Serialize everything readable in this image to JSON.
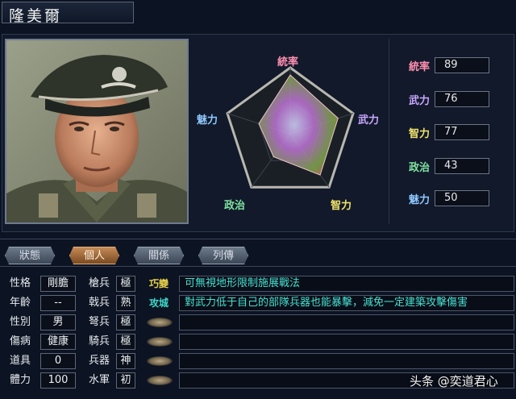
{
  "general_name": "隆美爾",
  "radar": {
    "labels": {
      "leadership": "統率",
      "strength": "武力",
      "intelligence": "智力",
      "politics": "政治",
      "charisma": "魅力"
    },
    "values": {
      "leadership": 89,
      "strength": 76,
      "intelligence": 77,
      "politics": 43,
      "charisma": 50
    },
    "max": 100
  },
  "stats": [
    {
      "name": "統率",
      "value": "89",
      "color": "#ff8fb0"
    },
    {
      "name": "武力",
      "value": "76",
      "color": "#c9a8ff"
    },
    {
      "name": "智力",
      "value": "77",
      "color": "#f2e26a"
    },
    {
      "name": "政治",
      "value": "43",
      "color": "#7fe3a0"
    },
    {
      "name": "魅力",
      "value": "50",
      "color": "#8fc8ff"
    }
  ],
  "tabs": [
    {
      "label": "狀態",
      "active": false
    },
    {
      "label": "個人",
      "active": true
    },
    {
      "label": "關係",
      "active": false
    },
    {
      "label": "列傳",
      "active": false
    }
  ],
  "personal": [
    {
      "label": "性格",
      "value": "剛膽"
    },
    {
      "label": "年齡",
      "value": "--"
    },
    {
      "label": "性別",
      "value": "男"
    },
    {
      "label": "傷病",
      "value": "健康"
    },
    {
      "label": "道具",
      "value": "0"
    },
    {
      "label": "體力",
      "value": "100"
    }
  ],
  "aptitudes": [
    {
      "label": "槍兵",
      "value": "極"
    },
    {
      "label": "戟兵",
      "value": "熟"
    },
    {
      "label": "弩兵",
      "value": "極"
    },
    {
      "label": "騎兵",
      "value": "極"
    },
    {
      "label": "兵器",
      "value": "神"
    },
    {
      "label": "水軍",
      "value": "初"
    }
  ],
  "skills": [
    {
      "name": "巧變",
      "desc": "可無視地形限制施展戰法",
      "color": "#e8d24a"
    },
    {
      "name": "攻城",
      "desc": "對武力低于自己的部隊兵器也能暴擊，減免一定建築攻擊傷害",
      "color": "#3fd9c9"
    },
    {
      "name": "",
      "desc": ""
    },
    {
      "name": "",
      "desc": ""
    },
    {
      "name": "",
      "desc": ""
    },
    {
      "name": "",
      "desc": ""
    }
  ],
  "watermark": "头条 @奕道君心",
  "colors": {
    "accent_tab": "#b8784a",
    "skill_text": "#48e0cf"
  }
}
